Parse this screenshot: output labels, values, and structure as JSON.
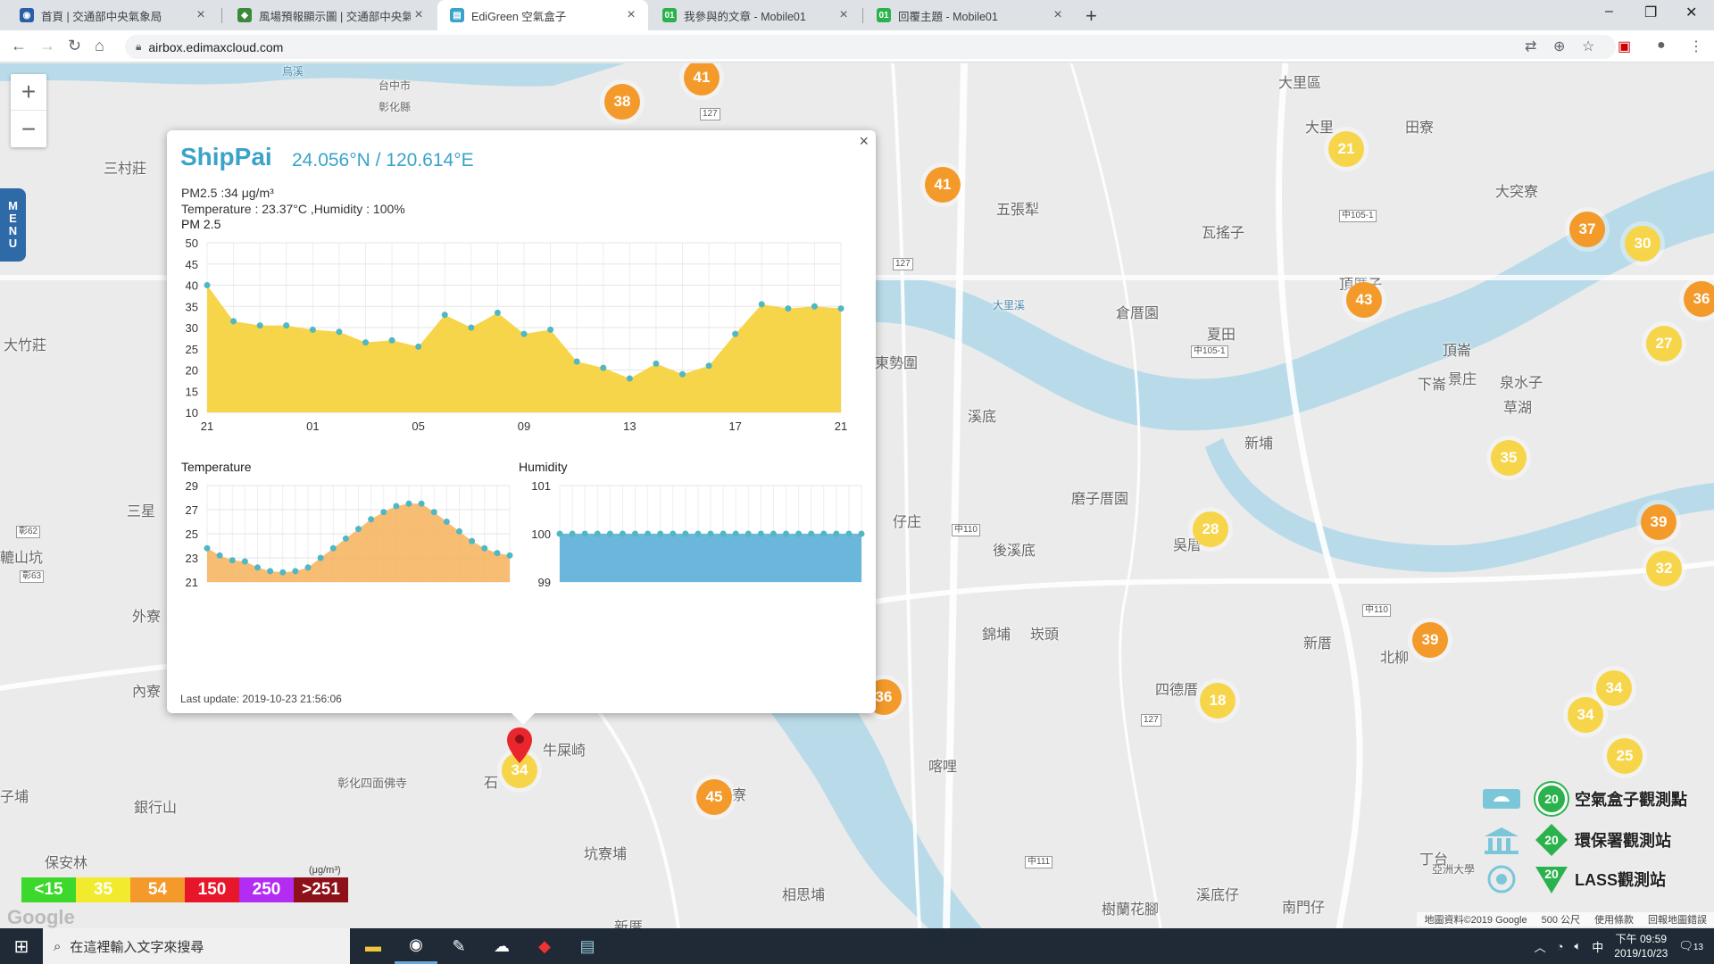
{
  "browser": {
    "tabs": [
      {
        "title": "首頁 | 交通部中央氣象局",
        "active": false,
        "favicon": "eye-favicon",
        "color": "#2a5fa8"
      },
      {
        "title": "風場預報顯示圖 | 交通部中央氣象",
        "active": false,
        "favicon": "cwb-favicon",
        "color": "#3a8a3a"
      },
      {
        "title": "EdiGreen 空氣盒子",
        "active": true,
        "favicon": "edigreen-favicon",
        "color": "#3aa3c9"
      },
      {
        "title": "我參與的文章 - Mobile01",
        "active": false,
        "favicon": "mobile01-favicon",
        "color": "#2bb24c"
      },
      {
        "title": "回覆主題 - Mobile01",
        "active": false,
        "favicon": "mobile01-favicon",
        "color": "#2bb24c"
      }
    ],
    "url": "airbox.edimaxcloud.com"
  },
  "map": {
    "menu_label": [
      "M",
      "E",
      "N",
      "U"
    ],
    "labels": [
      {
        "text": "大里區"
      },
      {
        "text": "田寮"
      },
      {
        "text": "大里"
      },
      {
        "text": "五張犁"
      },
      {
        "text": "瓦搖子"
      },
      {
        "text": "大突寮"
      },
      {
        "text": "頂厝子"
      },
      {
        "text": "倉厝園"
      },
      {
        "text": "夏田"
      },
      {
        "text": "東勢圍"
      },
      {
        "text": "溪底"
      },
      {
        "text": "新埔"
      },
      {
        "text": "景庄"
      },
      {
        "text": "泉水子"
      },
      {
        "text": "草湖"
      },
      {
        "text": "磨子厝園"
      },
      {
        "text": "後溪底"
      },
      {
        "text": "仔庄"
      },
      {
        "text": "錦埔"
      },
      {
        "text": "崁頭"
      },
      {
        "text": "新厝"
      },
      {
        "text": "北柳"
      },
      {
        "text": "四德厝"
      },
      {
        "text": "牛屎崎"
      },
      {
        "text": "銀行山"
      },
      {
        "text": "保安林"
      },
      {
        "text": "坑寮埔"
      },
      {
        "text": "溪尾寮"
      },
      {
        "text": "相思埔"
      },
      {
        "text": "樹蘭花腳"
      },
      {
        "text": "溪底仔"
      },
      {
        "text": "南門仔"
      },
      {
        "text": "丁台"
      },
      {
        "text": "三村莊"
      },
      {
        "text": "大竹莊"
      },
      {
        "text": "三星"
      },
      {
        "text": "轆山坑"
      },
      {
        "text": "外寮"
      },
      {
        "text": "內寮"
      },
      {
        "text": "子埔"
      },
      {
        "text": "頂崙"
      },
      {
        "text": "下崙"
      },
      {
        "text": "彰化四面佛寺"
      },
      {
        "text": "台中市"
      },
      {
        "text": "彰化縣"
      },
      {
        "text": "烏溪"
      },
      {
        "text": "大里溪"
      },
      {
        "text": "亞洲大學"
      },
      {
        "text": "喀哩"
      },
      {
        "text": "吳厝"
      },
      {
        "text": "石"
      },
      {
        "text": "新厝"
      }
    ],
    "roads": [
      {
        "text": "127"
      },
      {
        "text": "中105-1"
      },
      {
        "text": "中105-1"
      },
      {
        "text": "中110"
      },
      {
        "text": "中110"
      },
      {
        "text": "127"
      },
      {
        "text": "127"
      },
      {
        "text": "彰62"
      },
      {
        "text": "彰63"
      },
      {
        "text": "中111"
      }
    ],
    "clusters": [
      {
        "value": "41",
        "color": "orange"
      },
      {
        "value": "38",
        "color": "orange"
      },
      {
        "value": "41",
        "color": "orange"
      },
      {
        "value": "21",
        "color": "yellow"
      },
      {
        "value": "37",
        "color": "orange"
      },
      {
        "value": "30",
        "color": "yellow"
      },
      {
        "value": "43",
        "color": "orange"
      },
      {
        "value": "36",
        "color": "orange"
      },
      {
        "value": "27",
        "color": "yellow"
      },
      {
        "value": "35",
        "color": "yellow"
      },
      {
        "value": "28",
        "color": "yellow"
      },
      {
        "value": "39",
        "color": "orange"
      },
      {
        "value": "32",
        "color": "yellow"
      },
      {
        "value": "39",
        "color": "orange"
      },
      {
        "value": "18",
        "color": "yellow"
      },
      {
        "value": "34",
        "color": "yellow"
      },
      {
        "value": "34",
        "color": "yellow"
      },
      {
        "value": "25",
        "color": "yellow"
      },
      {
        "value": "36",
        "color": "orange"
      },
      {
        "value": "34",
        "color": "yellow"
      },
      {
        "value": "45",
        "color": "orange"
      }
    ],
    "legend_unit": "(μg/m³)",
    "aqi_legend": [
      {
        "label": "<15",
        "color": "#3cd82b"
      },
      {
        "label": "35",
        "color": "#f2ea2d"
      },
      {
        "label": "54",
        "color": "#f39a2b"
      },
      {
        "label": "150",
        "color": "#e8162a"
      },
      {
        "label": "250",
        "color": "#b32cf2"
      },
      {
        "label": ">251",
        "color": "#8e1018"
      }
    ],
    "station_legend": [
      {
        "label": "空氣盒子觀測點",
        "value": "20",
        "icon": "airbox-icon"
      },
      {
        "label": "環保署觀測站",
        "value": "20",
        "icon": "epa-building-icon"
      },
      {
        "label": "LASS觀測站",
        "value": "20",
        "icon": "lass-icon"
      }
    ],
    "attribution": {
      "copyright": "地圖資料©2019 Google",
      "scale": "500 公尺",
      "terms": "使用條款",
      "report": "回報地圖錯誤"
    },
    "google_logo": "Google"
  },
  "popup": {
    "station": "ShipPai",
    "coords": "24.056°N / 120.614°E",
    "pm25_line": "PM2.5 :34 μg/m³",
    "env_line": "Temperature : 23.37°C ,Humidity : 100%",
    "chart_label": "PM 2.5",
    "temp_label": "Temperature",
    "hum_label": "Humidity",
    "last_update": "Last update: 2019-10-23 21:56:06"
  },
  "chart_data": [
    {
      "type": "area",
      "title": "PM 2.5",
      "color": "#f7d54a",
      "x_ticks": [
        "21",
        "01",
        "05",
        "09",
        "13",
        "17",
        "21"
      ],
      "y_ticks": [
        10,
        15,
        20,
        25,
        30,
        35,
        40,
        45,
        50
      ],
      "ylim": [
        10,
        50
      ],
      "values": [
        40,
        31.5,
        30.5,
        30.5,
        29.5,
        29,
        26.5,
        27,
        25.5,
        33,
        30,
        33.5,
        28.5,
        29.5,
        22,
        20.5,
        18,
        21.5,
        19,
        21,
        28.5,
        35.5,
        34.5,
        35,
        34.5
      ]
    },
    {
      "type": "area",
      "title": "Temperature",
      "color": "#f5b25a",
      "y_ticks": [
        21,
        23,
        25,
        27,
        29
      ],
      "ylim": [
        21,
        29
      ],
      "values": [
        23.8,
        23.2,
        22.8,
        22.7,
        22.2,
        21.9,
        21.8,
        21.9,
        22.2,
        23.0,
        23.8,
        24.6,
        25.4,
        26.2,
        26.8,
        27.3,
        27.5,
        27.5,
        26.8,
        26.0,
        25.2,
        24.4,
        23.8,
        23.4,
        23.2
      ]
    },
    {
      "type": "area",
      "title": "Humidity",
      "color": "#6bb7dc",
      "y_ticks": [
        99,
        100,
        101
      ],
      "ylim": [
        99,
        101
      ],
      "values": [
        100,
        100,
        100,
        100,
        100,
        100,
        100,
        100,
        100,
        100,
        100,
        100,
        100,
        100,
        100,
        100,
        100,
        100,
        100,
        100,
        100,
        100,
        100,
        100,
        100
      ]
    }
  ],
  "taskbar": {
    "search_placeholder": "在這裡輸入文字來搜尋",
    "time": "下午 09:59",
    "date": "2019/10/23",
    "ime": "中",
    "notifications": "13"
  }
}
